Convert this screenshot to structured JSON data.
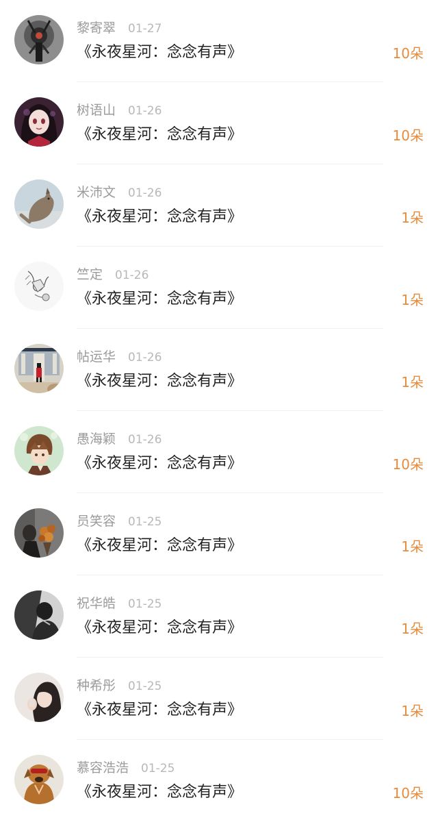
{
  "gift_list": [
    {
      "name": "黎寄翠",
      "date": "01-27",
      "title": "《永夜星河：念念有声》",
      "amount": "10朵",
      "avatar": "dark-art-avatar"
    },
    {
      "name": "树语山",
      "date": "01-26",
      "title": "《永夜星河：念念有声》",
      "amount": "10朵",
      "avatar": "anime-girl-avatar"
    },
    {
      "name": "米沛文",
      "date": "01-26",
      "title": "《永夜星河：念念有声》",
      "amount": "1朵",
      "avatar": "cat-avatar"
    },
    {
      "name": "竺定",
      "date": "01-26",
      "title": "《永夜星河：念念有声》",
      "amount": "1朵",
      "avatar": "sketch-avatar"
    },
    {
      "name": "帖运华",
      "date": "01-26",
      "title": "《永夜星河：念念有声》",
      "amount": "1朵",
      "avatar": "guard-avatar"
    },
    {
      "name": "愚海颖",
      "date": "01-26",
      "title": "《永夜星河：念念有声》",
      "amount": "10朵",
      "avatar": "anime-boy-avatar"
    },
    {
      "name": "员笑容",
      "date": "01-25",
      "title": "《永夜星河：念念有声》",
      "amount": "1朵",
      "avatar": "bouquet-avatar"
    },
    {
      "name": "祝华皓",
      "date": "01-25",
      "title": "《永夜星河：念念有声》",
      "amount": "1朵",
      "avatar": "mono-person-avatar"
    },
    {
      "name": "种希彤",
      "date": "01-25",
      "title": "《永夜星河：念念有声》",
      "amount": "1朵",
      "avatar": "girl-photo-avatar"
    },
    {
      "name": "慕容浩浩",
      "date": "01-25",
      "title": "《永夜星河：念念有声》",
      "amount": "10朵",
      "avatar": "dog-avatar"
    }
  ],
  "colors": {
    "amount": "#e78a3c",
    "name": "#9b9b9b",
    "date": "#b8b8b8",
    "title": "#222222"
  }
}
